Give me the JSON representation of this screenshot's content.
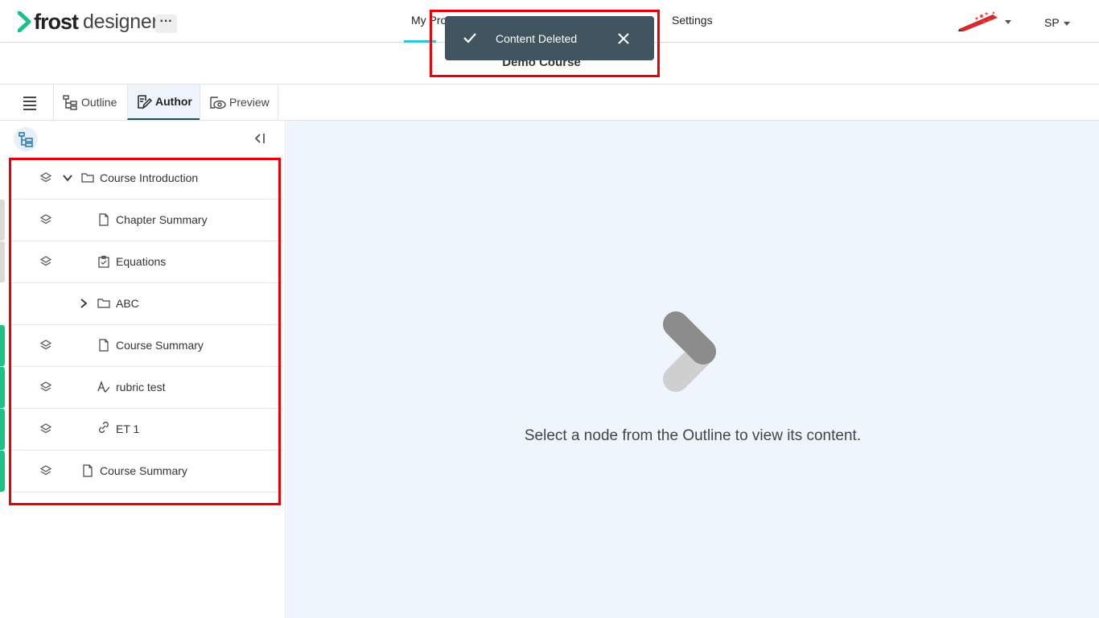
{
  "app": {
    "brand_bold": "frost",
    "brand_light": "designer",
    "more_label": "···"
  },
  "topnav": {
    "projects_label": "My Pro",
    "settings_label": "Settings",
    "user_initials": "SP"
  },
  "course": {
    "title": "Demo Course"
  },
  "tabs": [
    {
      "label": "Outline",
      "active": false
    },
    {
      "label": "Author",
      "active": true
    },
    {
      "label": "Preview",
      "active": false
    }
  ],
  "tree": [
    {
      "label": "Course Introduction",
      "type": "folder",
      "expanded": true,
      "level": 0,
      "status_color": ""
    },
    {
      "label": "Chapter Summary",
      "type": "page",
      "level": 1,
      "status_color": "#d9d9d9"
    },
    {
      "label": "Equations",
      "type": "assessment",
      "level": 1,
      "status_color": "#d9d9d9"
    },
    {
      "label": "ABC",
      "type": "folder",
      "expanded": false,
      "level": 1,
      "status_color": ""
    },
    {
      "label": "Course Summary",
      "type": "page",
      "level": 1,
      "status_color": "#1ec08a"
    },
    {
      "label": "rubric test",
      "type": "rubric",
      "level": 1,
      "status_color": "#1ec08a"
    },
    {
      "label": "ET 1",
      "type": "link",
      "level": 1,
      "status_color": "#1ec08a"
    },
    {
      "label": "Course Summary",
      "type": "page",
      "level": 0,
      "status_color": "#1ec08a"
    }
  ],
  "main": {
    "empty_message": "Select a node from the Outline to view its content."
  },
  "toast": {
    "message": "Content Deleted"
  },
  "colors": {
    "accent": "#2ec4d9",
    "toast_bg": "#40555f",
    "highlight": "#e8000b",
    "status_green": "#1ec08a"
  }
}
